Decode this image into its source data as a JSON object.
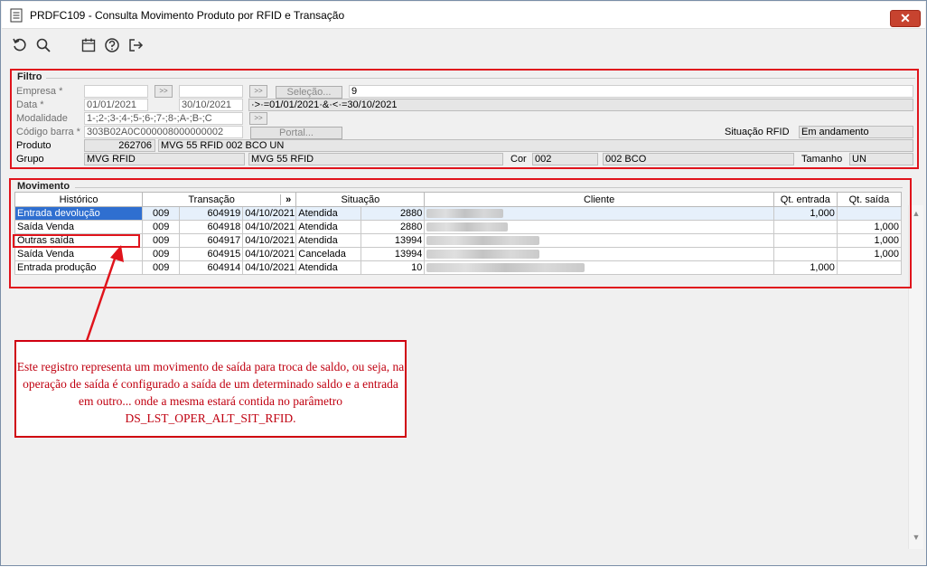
{
  "window": {
    "title": "PRDFC109 - Consulta Movimento Produto por RFID e Transação",
    "close_label": "✕"
  },
  "toolbar": {
    "icons": [
      "refresh-icon",
      "search-icon",
      "calendar-icon",
      "help-icon",
      "exit-icon"
    ]
  },
  "filtro": {
    "group_label": "Filtro",
    "empresa": {
      "label": "Empresa *",
      "value": ""
    },
    "data": {
      "label": "Data *",
      "start": "01/01/2021",
      "end": "30/10/2021"
    },
    "modalidade": {
      "label": "Modalidade",
      "value": "1-;2-;3-;4-;5-;6-;7-;8-;A-;B-;C"
    },
    "codigo_barra": {
      "label": "Código barra *",
      "value": "303B02A0C000008000000002"
    },
    "selecao_button": "Seleção...",
    "selecao_value": "9",
    "filter_expression": "·>·=01/01/2021·&·<·=30/10/2021",
    "portal_button": "Portal...",
    "situacao_rfid": {
      "label": "Situação RFID",
      "value": "Em andamento"
    },
    "produto": {
      "label": "Produto",
      "code": "262706",
      "desc": "MVG 55 RFID 002 BCO UN"
    },
    "grupo": {
      "label": "Grupo",
      "value1": "MVG RFID",
      "value2": "MVG 55 RFID"
    },
    "cor": {
      "label": "Cor",
      "code": "002",
      "desc": "002 BCO"
    },
    "tamanho": {
      "label": "Tamanho",
      "value": "UN"
    }
  },
  "movimento": {
    "group_label": "Movimento",
    "columns": {
      "historico": "Histórico",
      "transacao": "Transação",
      "expand": "»",
      "situacao": "Situação",
      "cliente": "Cliente",
      "qt_entrada": "Qt. entrada",
      "qt_saida": "Qt. saída"
    },
    "rows": [
      {
        "historico": "Entrada devolução",
        "empresa": "009",
        "transacao": "604919",
        "data": "04/10/2021",
        "situacao": "Atendida",
        "cliente_code": "2880",
        "qt_entrada": "1,000",
        "qt_saida": ""
      },
      {
        "historico": "Saída Venda",
        "empresa": "009",
        "transacao": "604918",
        "data": "04/10/2021",
        "situacao": "Atendida",
        "cliente_code": "2880",
        "qt_entrada": "",
        "qt_saida": "1,000"
      },
      {
        "historico": "Outras saída",
        "empresa": "009",
        "transacao": "604917",
        "data": "04/10/2021",
        "situacao": "Atendida",
        "cliente_code": "13994",
        "qt_entrada": "",
        "qt_saida": "1,000"
      },
      {
        "historico": "Saída Venda",
        "empresa": "009",
        "transacao": "604915",
        "data": "04/10/2021",
        "situacao": "Cancelada",
        "cliente_code": "13994",
        "qt_entrada": "",
        "qt_saida": "1,000"
      },
      {
        "historico": "Entrada produção",
        "empresa": "009",
        "transacao": "604914",
        "data": "04/10/2021",
        "situacao": "Atendida",
        "cliente_code": "10",
        "qt_entrada": "1,000",
        "qt_saida": ""
      }
    ]
  },
  "annotation": {
    "text": "Este registro representa um movimento de saída para troca de saldo, ou seja, na operação de saída é configurado a saída de um determinado saldo e a entrada em outro... onde a mesma estará contida no parâmetro DS_LST_OPER_ALT_SIT_RFID.",
    "color": "#c00010"
  },
  "colors": {
    "highlight_border": "#e0141c",
    "selection": "#2f6fd0",
    "close_button": "#c7432f"
  }
}
